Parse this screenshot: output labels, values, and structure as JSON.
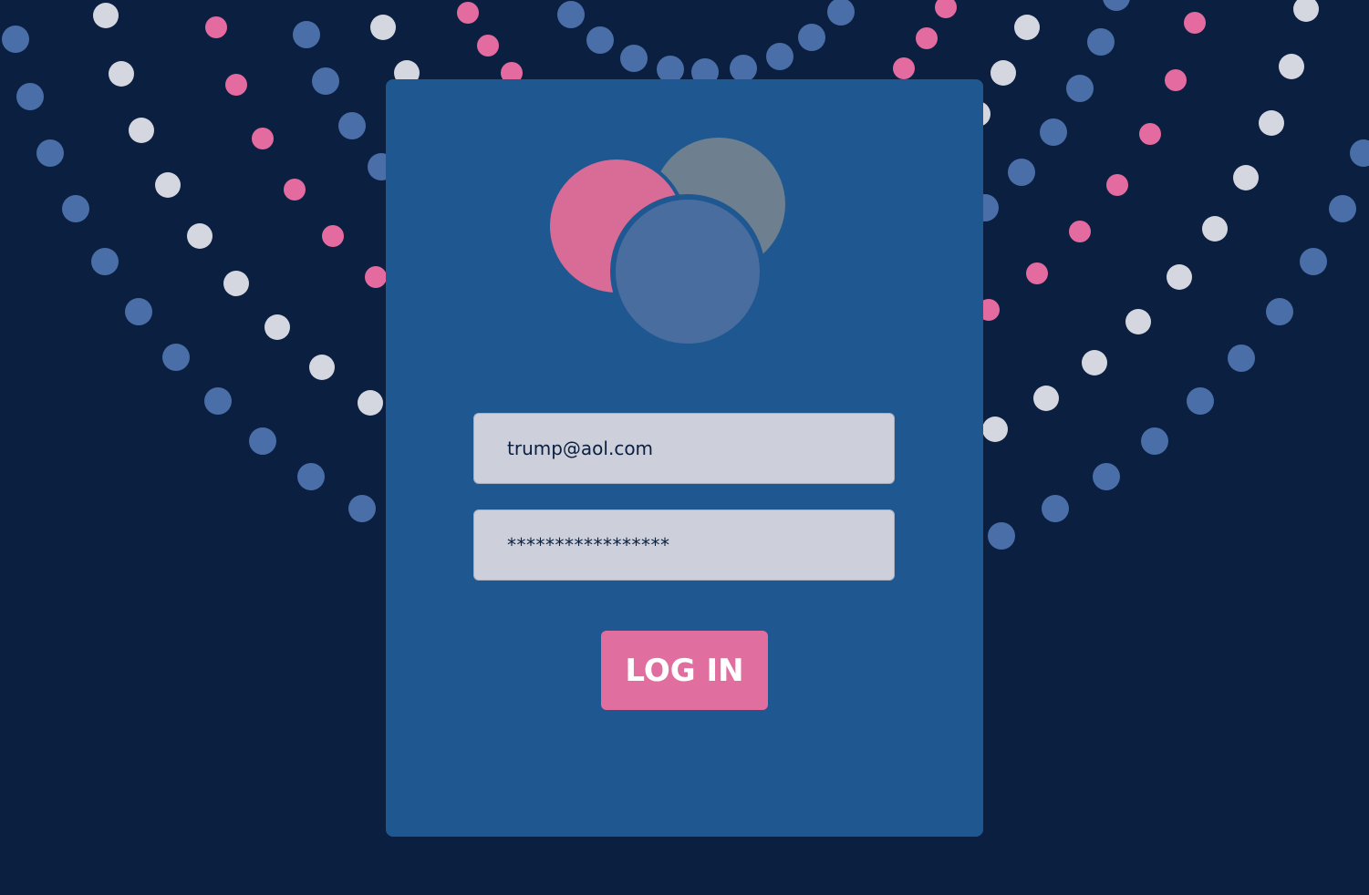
{
  "login_form": {
    "email_value": "trump@aol.com",
    "password_value": "*****************",
    "login_label": "LOG IN"
  },
  "colors": {
    "background": "#0b1f40",
    "card": "#1f5890",
    "field": "#cdd0da",
    "accent_pink": "#e06fa0",
    "dot_blue": "#4a6ea8",
    "dot_white": "#d4d6e0",
    "dot_pink": "#e36ba0",
    "logo_pink": "#d96b97",
    "logo_gray": "#6e8090",
    "logo_blue": "#4a6da0"
  }
}
